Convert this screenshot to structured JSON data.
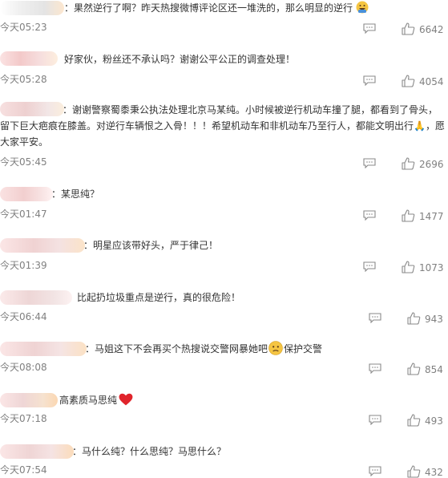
{
  "comments": [
    {
      "text": "：果然逆行了啊？昨天热搜微博评论区还一堆洗的，那么明显的逆行",
      "time": "今天05:23",
      "likes": "6642",
      "emoji": "grinning-face-emoji"
    },
    {
      "text": "好家伙，粉丝还不承认吗？谢谢公平公正的调查处理！",
      "time": "今天05:28",
      "likes": "4054"
    },
    {
      "text": "：谢谢警察蜀黍秉公执法处理北京马某纯。小时候被逆行机动车撞了腿，都看到了骨头，留下巨大疤痕在膝盖。对逆行车辆恨之入骨！！！希望机动车和非机动车乃至行人，都能文明出行🙏，愿大家平安。",
      "time": "今天05:45",
      "likes": "2696"
    },
    {
      "text": "：某思纯？",
      "time": "今天01:47",
      "likes": "1477"
    },
    {
      "text": "：明星应该带好头，严于律己！",
      "time": "今天01:39",
      "likes": "1073"
    },
    {
      "text": "比起扔垃圾重点是逆行，真的很危险！",
      "time": "今天06:44",
      "likes": "943"
    },
    {
      "text_before": "：马姐这下不会再买个热搜说交警网暴她吧",
      "text_after": "保护交警",
      "time": "今天08:08",
      "likes": "854",
      "emoji": "worried-face-emoji"
    },
    {
      "text": "高素质马思纯",
      "time": "今天07:18",
      "likes": "493",
      "emoji": "red-heart-emoji"
    },
    {
      "text": "：马什么纯？什么思纯？马思什么？",
      "time": "今天07:54",
      "likes": "432"
    }
  ],
  "icons": {
    "reply": "comment-reply-icon",
    "like": "thumbs-up-icon"
  },
  "colors": {
    "text": "#333333",
    "meta": "#808080",
    "icon": "#8a8a8a"
  }
}
